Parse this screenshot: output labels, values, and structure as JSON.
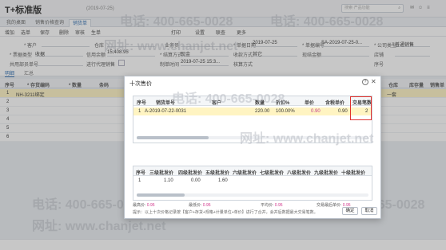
{
  "app": {
    "title": "T+标准版",
    "date": "(2019-07-25)",
    "search_placeholder": "搜索·产品功能"
  },
  "tabs": [
    "我的桌面",
    "销售价格查询",
    "销货单"
  ],
  "toolbar": [
    "增加",
    "选单",
    "保存",
    "删除",
    "审核",
    "生单",
    "打印",
    "设置",
    "联查",
    "更多"
  ],
  "form": {
    "customer_label": "* 客户",
    "customer_value": "",
    "warehouse_label": "仓库",
    "business_label": "业务员",
    "doc_date_label": "* 单据日期",
    "doc_date_value": "2019-07-25",
    "doc_no_label": "* 单据编号",
    "doc_no_value": "SA-2019-07-25-0...",
    "company_label": "* 公司类型",
    "company_value": "普通销售",
    "vouch_label": "* 票据类型",
    "vouch_value": "收据",
    "credit_label": "信用余额",
    "credit_value": "15,408.95",
    "settle_label": "* 结算方式",
    "settle_value": "现金",
    "dept_label": "收款方式",
    "dept_value": "其它",
    "shop_label": "现结金额",
    "store_label": "店铺",
    "project_label": "共用部员单号",
    "sync_label": "进行代理销售",
    "maker_label": "制单时间",
    "maker_value": "2019-07-25 15:3...",
    "audit_label": "核算方式",
    "serial_label": "序号"
  },
  "subtabs": [
    "明细",
    "汇总"
  ],
  "grid": {
    "headers": [
      "序号",
      "* 存货编码",
      "* 数量",
      "条码",
      "仓库",
      "库存量",
      "销售单位"
    ],
    "rows": [
      {
        "no": "1",
        "code": "NH-3211绑定",
        "unit": "一套"
      },
      {
        "no": "2",
        "code": "",
        "unit": ""
      },
      {
        "no": "3",
        "code": "",
        "unit": ""
      },
      {
        "no": "4",
        "code": "",
        "unit": ""
      },
      {
        "no": "5",
        "code": "",
        "unit": ""
      },
      {
        "no": "6",
        "code": "",
        "unit": ""
      }
    ]
  },
  "modal": {
    "title": "十次售价",
    "help": "?",
    "close": "✕",
    "table1": {
      "headers": [
        "序号",
        "销货单号",
        "客户",
        "数量",
        "折扣%",
        "单价",
        "含税单价",
        "交易笔数"
      ],
      "row": {
        "no": "1",
        "doc": "A-2019-07-22-0031",
        "customer": "",
        "qty": "220.00",
        "discount": "100.00%",
        "price": "0.90",
        "tax_price": "0.90",
        "count": "2"
      }
    },
    "table2": {
      "headers": [
        "序号",
        "三级批发价",
        "四级批发价",
        "五级批发价",
        "六级批发价",
        "七级批发价",
        "八级批发价",
        "九级批发价",
        "十级批发价"
      ],
      "row": {
        "no": "1",
        "l3": "1.10",
        "l4": "0.00",
        "l5": "1.60"
      }
    },
    "summary": {
      "high_label": "最高价:",
      "high_value": "0.95",
      "low_label": "最低价:",
      "low_value": "0.95",
      "avg_label": "平均价:",
      "avg_value": "0.95",
      "last_label": "交易最后单价:",
      "last_value": "0.95"
    },
    "note": "提示：以上十次价格记录按【客户+存货+规格+计量单位+单价】进行了合并，会并后数据最大交易笔数。",
    "ok_label": "确定",
    "cancel_label": "取消"
  },
  "watermark": {
    "phone": "电话: 400-665-0028",
    "site": "网址: www.chanjet.net"
  }
}
